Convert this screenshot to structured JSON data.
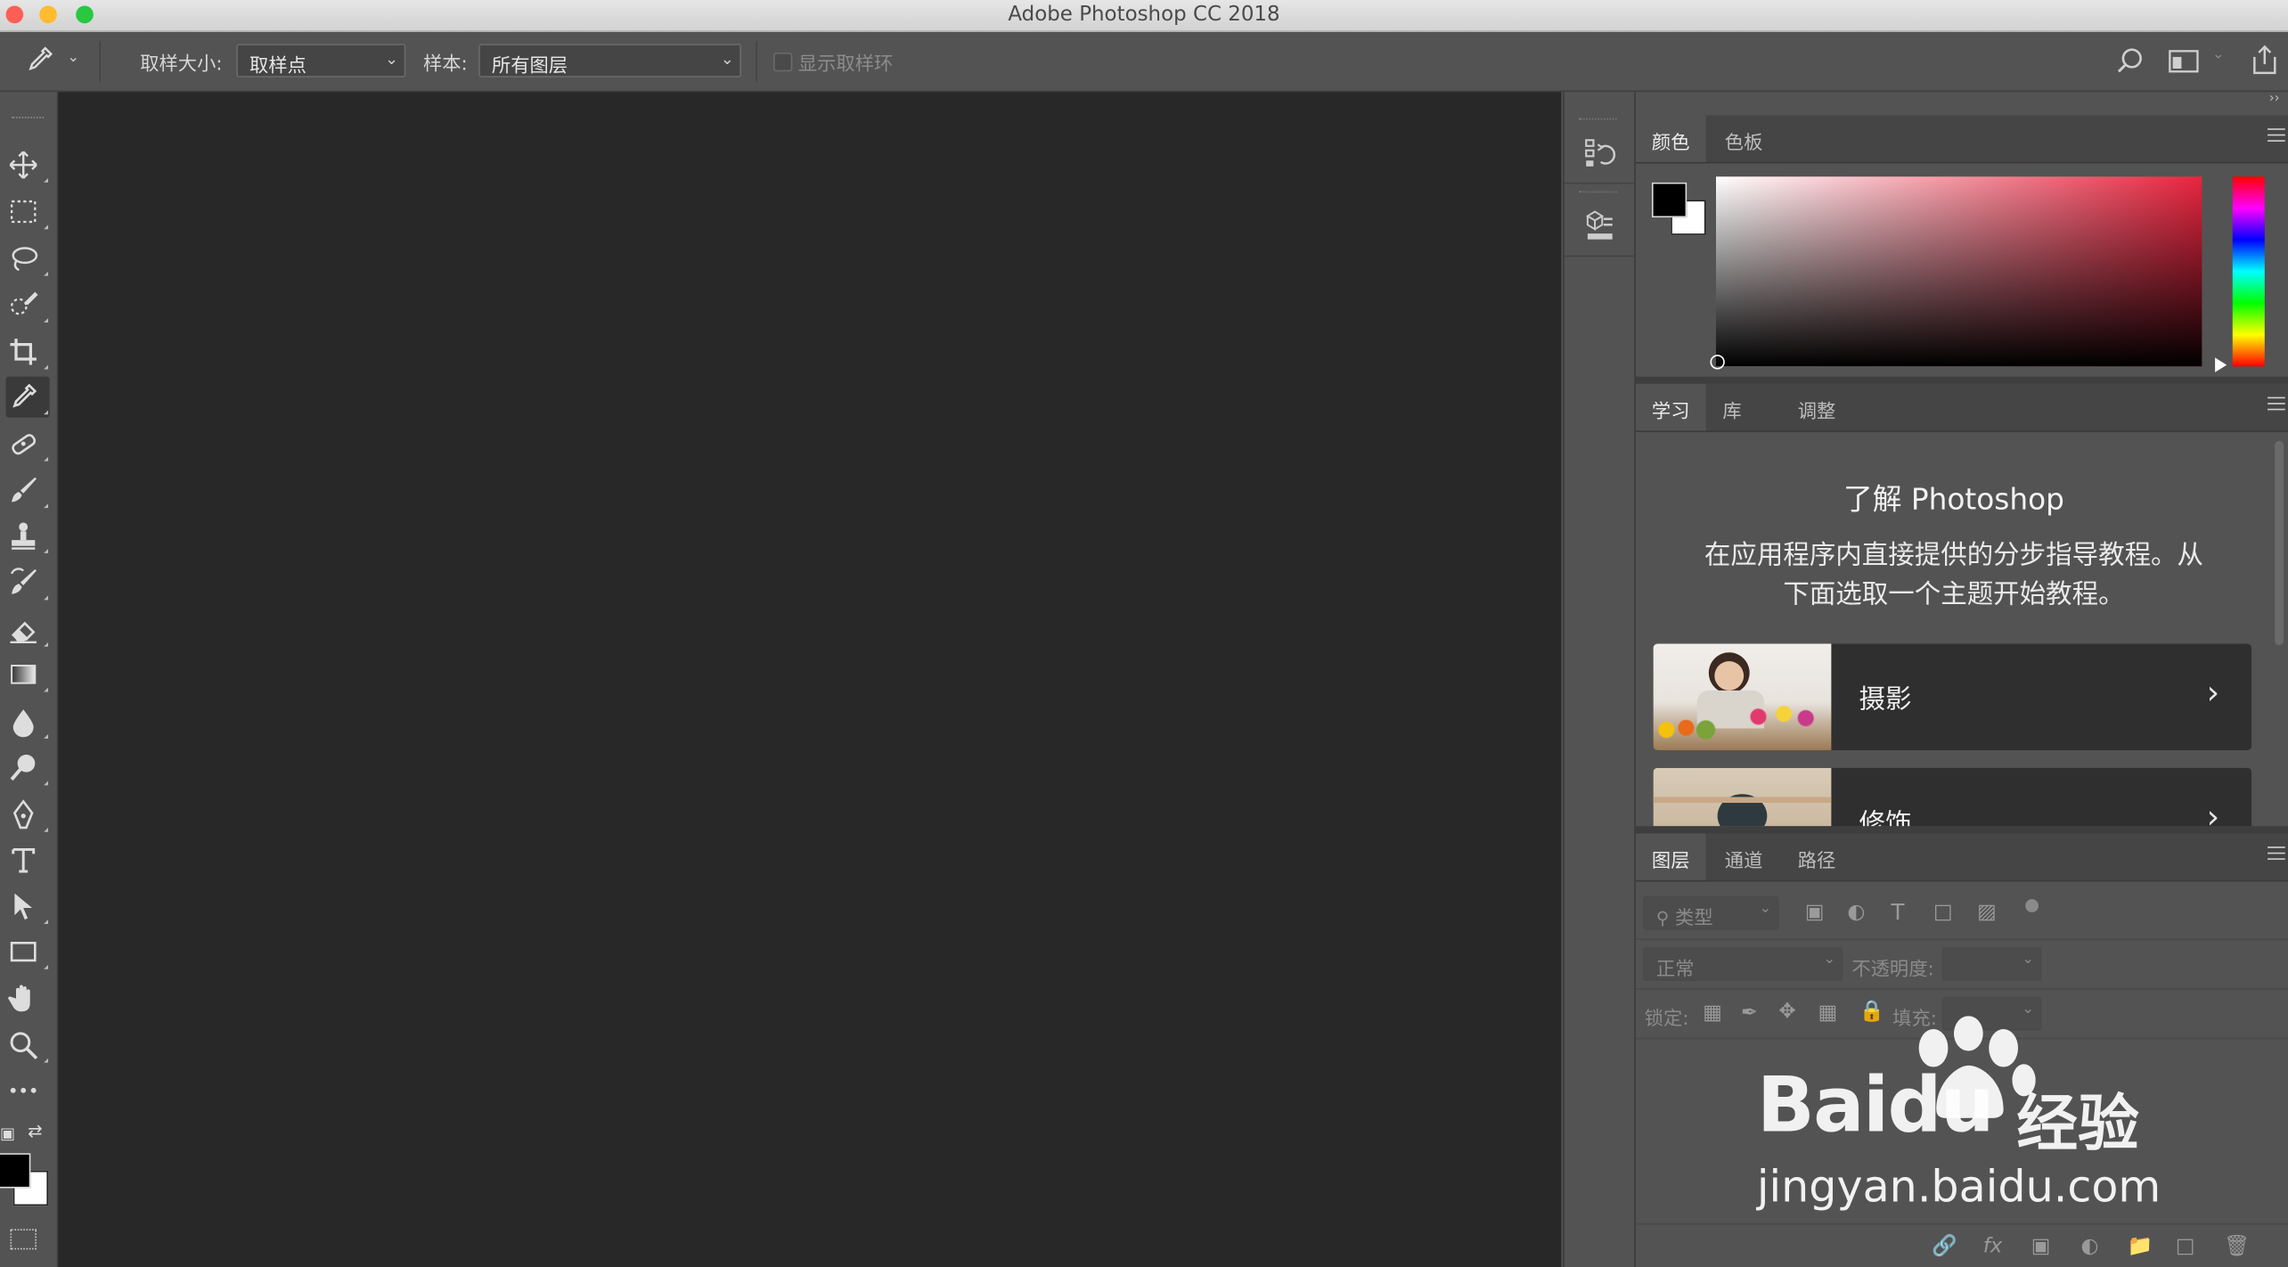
{
  "window": {
    "title": "Adobe Photoshop CC 2018",
    "traffic_lights": {
      "close": "#fd5f57",
      "minimize": "#febc2e",
      "zoom": "#28c840"
    }
  },
  "options_bar": {
    "sample_size_label": "取样大小:",
    "sample_size_value": "取样点",
    "sample_label": "样本:",
    "sample_value": "所有图层",
    "show_ring_label": "显示取样环"
  },
  "tools": [
    {
      "name": "move-tool",
      "icon": "move-icon"
    },
    {
      "name": "marquee-tool",
      "icon": "marquee-icon"
    },
    {
      "name": "lasso-tool",
      "icon": "lasso-icon"
    },
    {
      "name": "quick-select-tool",
      "icon": "quick-select-icon"
    },
    {
      "name": "crop-tool",
      "icon": "crop-icon"
    },
    {
      "name": "eyedropper-tool",
      "icon": "eyedropper-icon",
      "active": true
    },
    {
      "name": "healing-brush-tool",
      "icon": "bandage-icon"
    },
    {
      "name": "brush-tool",
      "icon": "brush-icon"
    },
    {
      "name": "clone-stamp-tool",
      "icon": "stamp-icon"
    },
    {
      "name": "history-brush-tool",
      "icon": "history-brush-icon"
    },
    {
      "name": "eraser-tool",
      "icon": "eraser-icon"
    },
    {
      "name": "gradient-tool",
      "icon": "gradient-icon"
    },
    {
      "name": "blur-tool",
      "icon": "drop-icon"
    },
    {
      "name": "dodge-tool",
      "icon": "dodge-icon"
    },
    {
      "name": "pen-tool",
      "icon": "pen-icon"
    },
    {
      "name": "type-tool",
      "icon": "type-icon"
    },
    {
      "name": "path-select-tool",
      "icon": "arrow-icon"
    },
    {
      "name": "rectangle-tool",
      "icon": "rectangle-icon"
    },
    {
      "name": "hand-tool",
      "icon": "hand-icon"
    },
    {
      "name": "zoom-tool",
      "icon": "zoom-icon"
    },
    {
      "name": "more-tools",
      "icon": "more-icon"
    }
  ],
  "color_panel": {
    "tabs": [
      "颜色",
      "色板"
    ],
    "foreground": "#000000",
    "background": "#ffffff",
    "hue": "#e8253f"
  },
  "learn_panel": {
    "tabs": [
      "学习",
      "库",
      "调整"
    ],
    "title": "了解 Photoshop",
    "description_line1": "在应用程序内直接提供的分步指导教程。从",
    "description_line2": "下面选取一个主题开始教程。",
    "cards": [
      {
        "label": "摄影",
        "icon": "chevron-right-icon"
      },
      {
        "label": "修饰",
        "icon": "chevron-right-icon"
      }
    ]
  },
  "layers_panel": {
    "tabs": [
      "图层",
      "通道",
      "路径"
    ],
    "filter_placeholder": "类型",
    "blend_mode": "正常",
    "opacity_label": "不透明度:",
    "lock_label": "锁定:",
    "fill_label": "填充:"
  },
  "watermark": {
    "brand": "Baidu",
    "brand_cn": "经验",
    "url": "jingyan.baidu.com"
  }
}
